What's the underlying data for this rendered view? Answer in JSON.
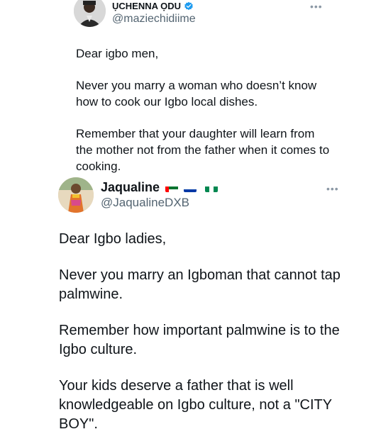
{
  "tweet1": {
    "display_name": "ỤCHENNA ỌDU",
    "handle": "@maziechidiime",
    "more_icon": "more-horizontal-icon",
    "paragraphs": [
      "Dear igbo men,",
      "Never you marry a woman who doesn’t know how to cook our Igbo local dishes.",
      "Remember that your daughter will learn from the mother not from the father when it comes to cooking."
    ]
  },
  "tweet2": {
    "display_name": "Jaqualine",
    "handle": "@JaqualineDXB",
    "flags": [
      "uae-flag-icon",
      "russia-flag-icon",
      "nigeria-flag-icon"
    ],
    "more_icon": "more-horizontal-icon",
    "paragraphs": [
      "Dear Igbo ladies,",
      "Never you marry an Igboman that cannot tap palmwine.",
      "Remember how important palmwine is to the Igbo culture.",
      "Your kids deserve a father that is well knowledgeable on Igbo culture, not a \"CITY BOY\"."
    ]
  },
  "colors": {
    "verified_badge": "#1d9bf0",
    "secondary_text": "#536471",
    "primary_text": "#0f1419"
  }
}
